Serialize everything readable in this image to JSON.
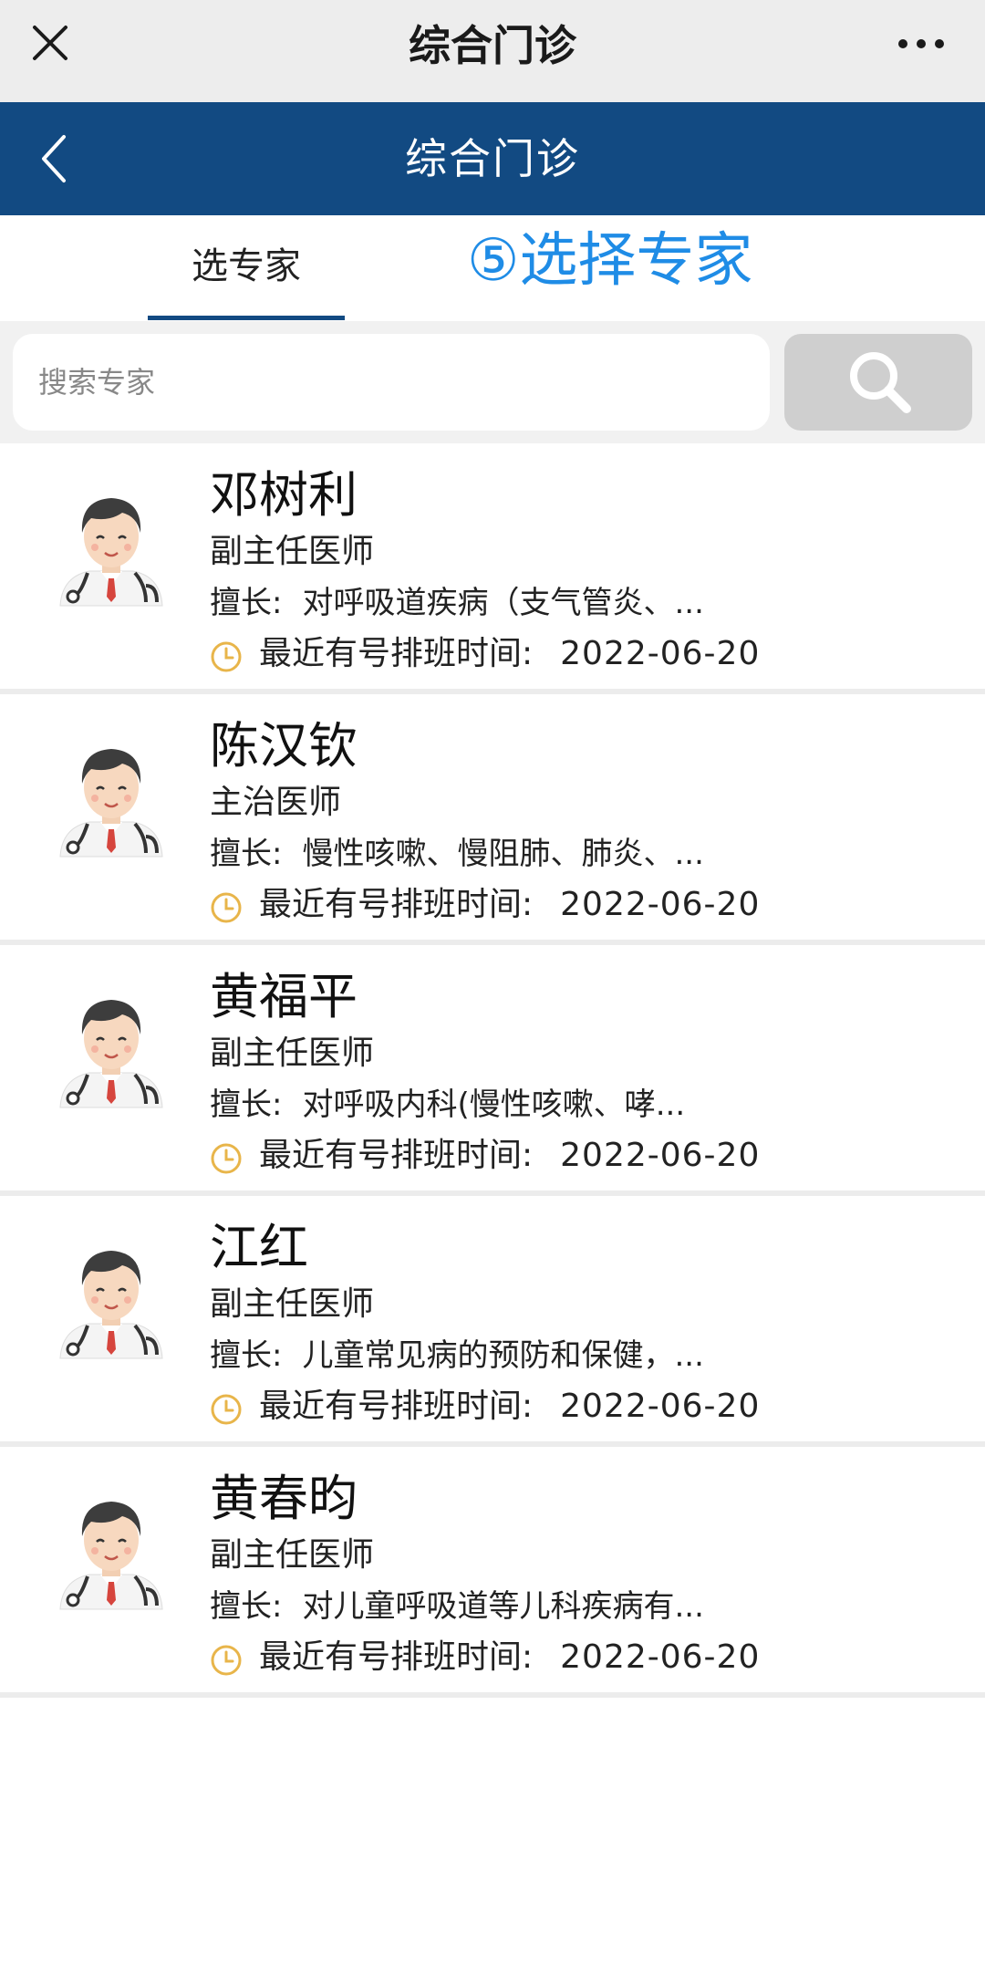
{
  "wechat_bar": {
    "title": "综合门诊",
    "close_icon": "close-icon",
    "more_icon": "more-icon"
  },
  "header": {
    "title": "综合门诊",
    "back_icon": "chevron-left-icon",
    "color": "#124a82"
  },
  "tabs": [
    {
      "label": "选专家",
      "active": true
    }
  ],
  "annotation": "⑤选择专家",
  "search": {
    "placeholder": "搜索专家",
    "button_icon": "search-icon"
  },
  "doctors": [
    {
      "name": "邓树利",
      "title": "副主任医师",
      "specialty_label": "擅长:",
      "specialty": "对呼吸道疾病（支气管炎、...",
      "schedule_label": "最近有号排班时间:",
      "schedule_date": "2022-06-20"
    },
    {
      "name": "陈汉钦",
      "title": "主治医师",
      "specialty_label": "擅长:",
      "specialty": "慢性咳嗽、慢阻肺、肺炎、...",
      "schedule_label": "最近有号排班时间:",
      "schedule_date": "2022-06-20"
    },
    {
      "name": "黄福平",
      "title": "副主任医师",
      "specialty_label": "擅长:",
      "specialty": "对呼吸内科(慢性咳嗽、哮...",
      "schedule_label": "最近有号排班时间:",
      "schedule_date": "2022-06-20"
    },
    {
      "name": "江红",
      "title": "副主任医师",
      "specialty_label": "擅长:",
      "specialty": "儿童常见病的预防和保健，...",
      "schedule_label": "最近有号排班时间:",
      "schedule_date": "2022-06-20"
    },
    {
      "name": "黄春昀",
      "title": "副主任医师",
      "specialty_label": "擅长:",
      "specialty": "对儿童呼吸道等儿科疾病有...",
      "schedule_label": "最近有号排班时间:",
      "schedule_date": "2022-06-20"
    }
  ],
  "colors": {
    "accent": "#124a82",
    "annotation": "#1f8ce6",
    "clock": "#e8b54a"
  }
}
